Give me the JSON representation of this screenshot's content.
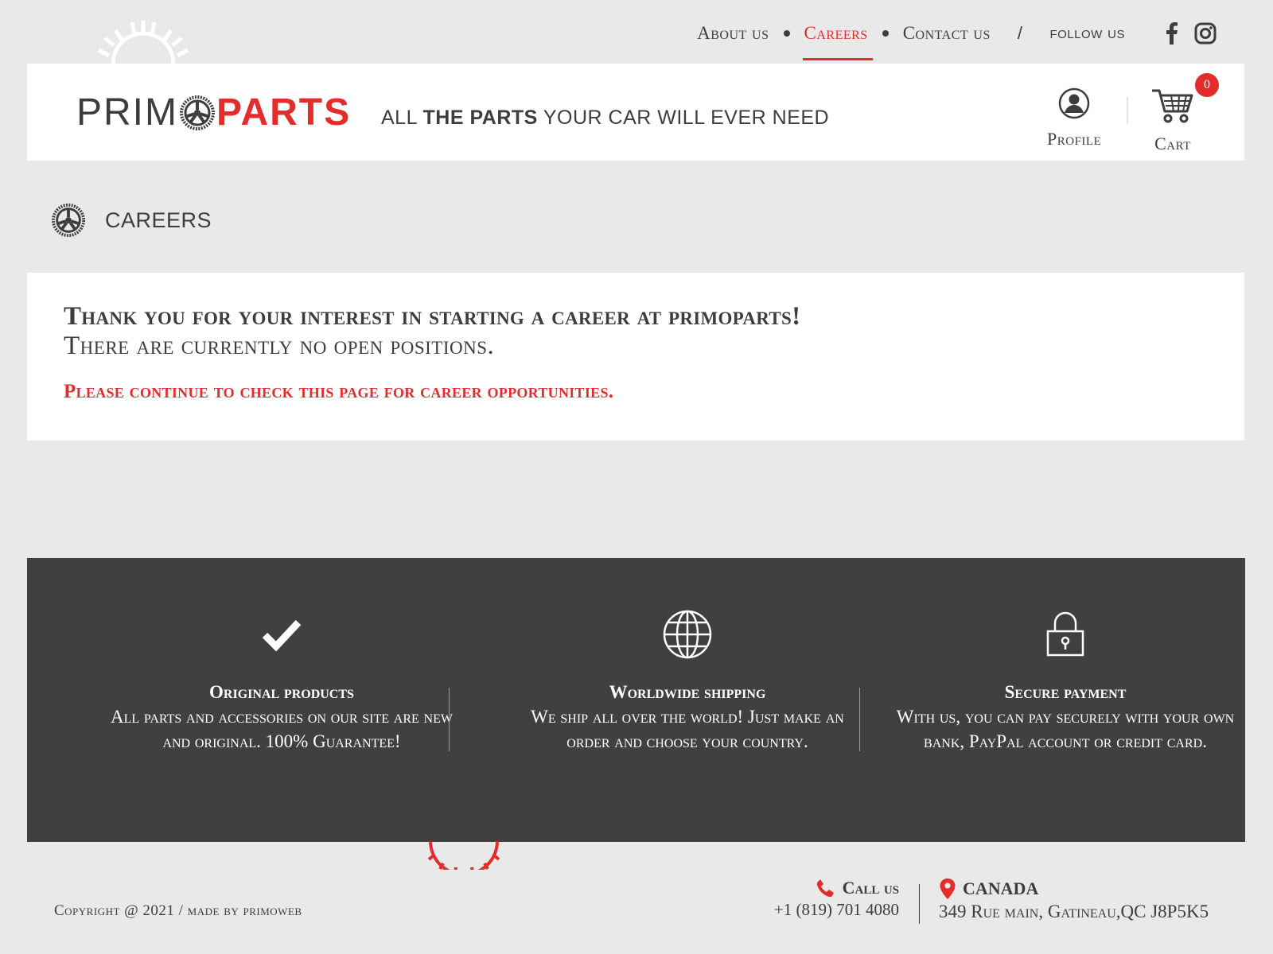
{
  "nav": {
    "items": [
      {
        "label": "About us"
      },
      {
        "label": "Careers",
        "active": true
      },
      {
        "label": "Contact us"
      }
    ],
    "slash": "/",
    "follow": "follow us",
    "social": [
      "facebook-icon",
      "instagram-icon"
    ]
  },
  "brand": {
    "prim": "PRIM",
    "parts": "PARTS",
    "tagline_a": "ALL ",
    "tagline_b": "THE PARTS",
    "tagline_c": " YOUR CAR  WILL EVER NEED"
  },
  "header": {
    "profile_label": "Profile",
    "cart_label": "Cart",
    "cart_count": "0"
  },
  "page": {
    "title": "CAREERS"
  },
  "content": {
    "line1": "Thank you for your interest in starting a career at primoparts!",
    "line2": "There are currently no open positions.",
    "line3": "Please continue to check this page for career opportunities."
  },
  "features": [
    {
      "icon": "check-icon",
      "title": "Original products",
      "desc": "All parts and accessories on our site are new and original. 100% Guarantee!"
    },
    {
      "icon": "globe-icon",
      "title": "Worldwide shipping",
      "desc": "We ship all over the world! Just make an order and choose your country."
    },
    {
      "icon": "lock-icon",
      "title": "Secure payment",
      "desc": "With us, you can pay securely with your own bank, PayPal account or credit card."
    }
  ],
  "footer": {
    "copyright": "Copyright @ 2021 /  made by primoweb",
    "call_label": "Call us",
    "phone": "+1 (819) 701 4080",
    "country": "CANADA",
    "address": "349 Rue main, Gatineau,QC J8P5K5"
  },
  "colors": {
    "accent": "#e32d2d",
    "dark": "#404040",
    "background": "#e9e9e9"
  }
}
